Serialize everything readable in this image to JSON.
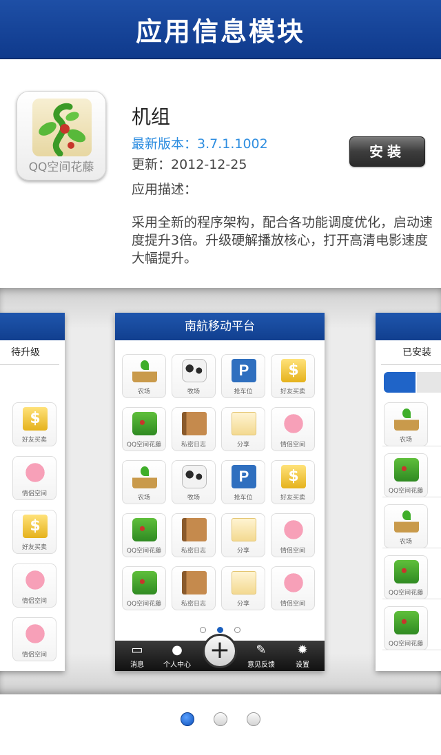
{
  "header": {
    "title": "应用信息模块"
  },
  "app": {
    "icon_label": "QQ空间花藤",
    "name": "机组",
    "version": "最新版本：3.7.1.1002",
    "updated": "更新：2012-12-25",
    "desc_label": "应用描述：",
    "description": "采用全新的程序架构，配合各功能调度优化，启动速度提升3倍。升级硬解播放核心，打开高清电影速度大幅提升。",
    "install_label": "安装"
  },
  "screenshot_center": {
    "title": "南航移动平台",
    "tiles": [
      {
        "label": "农场",
        "icon": "sprout-icon"
      },
      {
        "label": "牧场",
        "icon": "cow-icon"
      },
      {
        "label": "抢车位",
        "icon": "parking-icon"
      },
      {
        "label": "好友买卖",
        "icon": "money-icon"
      },
      {
        "label": "QQ空间花藤",
        "icon": "vine-icon"
      },
      {
        "label": "私密日志",
        "icon": "diary-icon"
      },
      {
        "label": "分享",
        "icon": "share-icon"
      },
      {
        "label": "情侣空间",
        "icon": "heart-icon"
      },
      {
        "label": "农场",
        "icon": "sprout-icon"
      },
      {
        "label": "牧场",
        "icon": "cow-icon"
      },
      {
        "label": "抢车位",
        "icon": "parking-icon"
      },
      {
        "label": "好友买卖",
        "icon": "money-icon"
      },
      {
        "label": "QQ空间花藤",
        "icon": "vine-icon"
      },
      {
        "label": "私密日志",
        "icon": "diary-icon"
      },
      {
        "label": "分享",
        "icon": "share-icon"
      },
      {
        "label": "情侣空间",
        "icon": "heart-icon"
      },
      {
        "label": "QQ空间花藤",
        "icon": "vine-icon"
      },
      {
        "label": "私密日志",
        "icon": "diary-icon"
      },
      {
        "label": "分享",
        "icon": "share-icon"
      },
      {
        "label": "情侣空间",
        "icon": "heart-icon"
      }
    ],
    "toolbar": {
      "messages": "消息",
      "profile": "个人中心",
      "feedback": "意见反馈",
      "settings": "设置"
    }
  },
  "screenshot_left": {
    "tab": "待升级",
    "tiles": [
      "好友买卖",
      "情侣空间",
      "好友买卖",
      "情侣空间",
      "情侣空间"
    ]
  },
  "screenshot_right": {
    "tab": "已安装",
    "rows": [
      "农场",
      "QQ空间花藤",
      "农场",
      "QQ空间花藤",
      "QQ空间花藤"
    ]
  },
  "pager": {
    "pages": 3,
    "active": 1
  }
}
